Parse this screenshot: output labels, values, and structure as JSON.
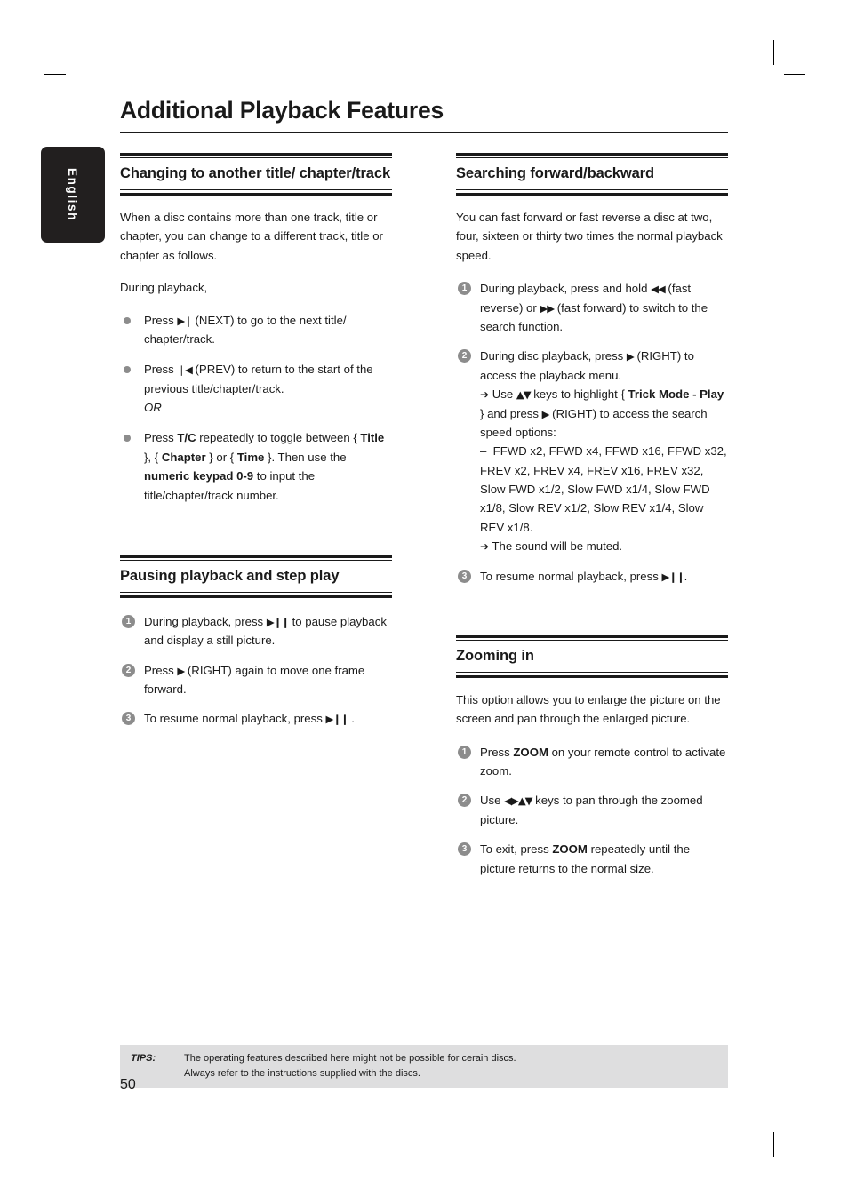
{
  "page": {
    "title": "Additional Playback Features",
    "language_tab": "English",
    "page_number": "50"
  },
  "left_column": {
    "section1": {
      "heading": "Changing to another title/ chapter/track",
      "intro": "When a disc contains more than one track, title or chapter, you can change to a different track, title or chapter as follows.",
      "lead_in": "During playback,",
      "bullets": [
        {
          "text_before": "Press ",
          "glyph": "▶❘",
          "glyph_name": "next-track-icon",
          "text_after": " (NEXT) to go to the next title/ chapter/track."
        },
        {
          "text_before": "Press ",
          "glyph": "❘◀",
          "glyph_name": "previous-track-icon",
          "text_after": " (PREV) to return to the start of the previous title/chapter/track.",
          "or_note": "OR"
        },
        {
          "text_before": "Press ",
          "bold1": "T/C",
          "mid1": " repeatedly to toggle between { ",
          "bold2": "Title",
          "mid2": " }, { ",
          "bold3": "Chapter",
          "mid3": " } or { ",
          "bold4": "Time",
          "mid4": " }. Then use the ",
          "bold5": "numeric keypad 0-9",
          "mid5": " to input the title/chapter/track number."
        }
      ]
    },
    "section2": {
      "heading": "Pausing playback and step play",
      "steps": [
        {
          "num": "1",
          "text_before": "During playback, press ",
          "glyph": "▶❙❙",
          "glyph_name": "play-pause-icon",
          "text_after": "  to pause playback and display a still picture."
        },
        {
          "num": "2",
          "text_before": "Press ",
          "glyph": "▶",
          "glyph_name": "right-arrow-icon",
          "text_after": " (RIGHT) again to move one frame forward."
        },
        {
          "num": "3",
          "text_before": "To resume normal playback, press ",
          "glyph": "▶❙❙",
          "glyph_name": "play-pause-icon",
          "text_after": " ."
        }
      ]
    }
  },
  "right_column": {
    "section1": {
      "heading": "Searching forward/backward",
      "intro": "You can fast forward or fast reverse a disc at two, four, sixteen or thirty two times the normal playback speed.",
      "steps": [
        {
          "num": "1",
          "text_before": "During playback, press and hold ",
          "glyph1": "◀◀",
          "glyph1_name": "fast-reverse-icon",
          "mid": " (fast reverse) or ",
          "glyph2": "▶▶",
          "glyph2_name": "fast-forward-icon",
          "text_after": " (fast forward) to switch to the search function."
        },
        {
          "num": "2",
          "text_before": "During disc playback, press ",
          "glyph1": "▶",
          "glyph1_name": "right-arrow-icon",
          "text_after": " (RIGHT) to access the playback menu.",
          "sub1_arrow": "➔",
          "sub1_before": " Use ",
          "sub1_glyph": "▲▼",
          "sub1_glyph_name": "up-down-arrow-icon",
          "sub1_mid": " keys to highlight { ",
          "sub1_bold": "Trick Mode - Play",
          "sub1_mid2": " } and press ",
          "sub1_glyph2": "▶",
          "sub1_glyph2_name": "right-arrow-icon",
          "sub1_after": " (RIGHT) to access the search speed options:",
          "options_dash": "–",
          "options": "FFWD x2, FFWD x4, FFWD x16, FFWD x32, FREV x2, FREV x4, FREV x16, FREV x32, Slow FWD x1/2, Slow FWD x1/4, Slow FWD x1/8, Slow REV x1/2, Slow REV x1/4, Slow REV x1/8.",
          "sub2_arrow": "➔",
          "sub2_text": " The sound will be muted."
        },
        {
          "num": "3",
          "text_before": "To resume normal playback, press ",
          "glyph1": "▶❙❙",
          "glyph1_name": "play-pause-icon",
          "text_after": "."
        }
      ]
    },
    "section2": {
      "heading": "Zooming in",
      "intro": "This option allows you to enlarge the picture on the screen and pan through the enlarged picture.",
      "steps": [
        {
          "num": "1",
          "text_before": "Press ",
          "bold": "ZOOM",
          "text_after": " on your remote control to activate zoom."
        },
        {
          "num": "2",
          "text_before": "Use ",
          "glyph": "◀▶▲▼",
          "glyph_name": "direction-pad-arrows-icon",
          "text_after": " keys to pan through the zoomed picture."
        },
        {
          "num": "3",
          "text_before": "To exit, press ",
          "bold": "ZOOM",
          "text_after": " repeatedly until the picture returns to the normal size."
        }
      ]
    }
  },
  "footer": {
    "tips_label": "TIPS:",
    "tips_line1": "The operating features described here might not be possible for cerain discs.",
    "tips_line2": "Always refer to the instructions supplied with the discs."
  },
  "colors": {
    "text": "#1a1a1a",
    "bullet_gray": "#8c8c8c",
    "tips_background": "#dededf",
    "tab_background": "#221f1f"
  }
}
